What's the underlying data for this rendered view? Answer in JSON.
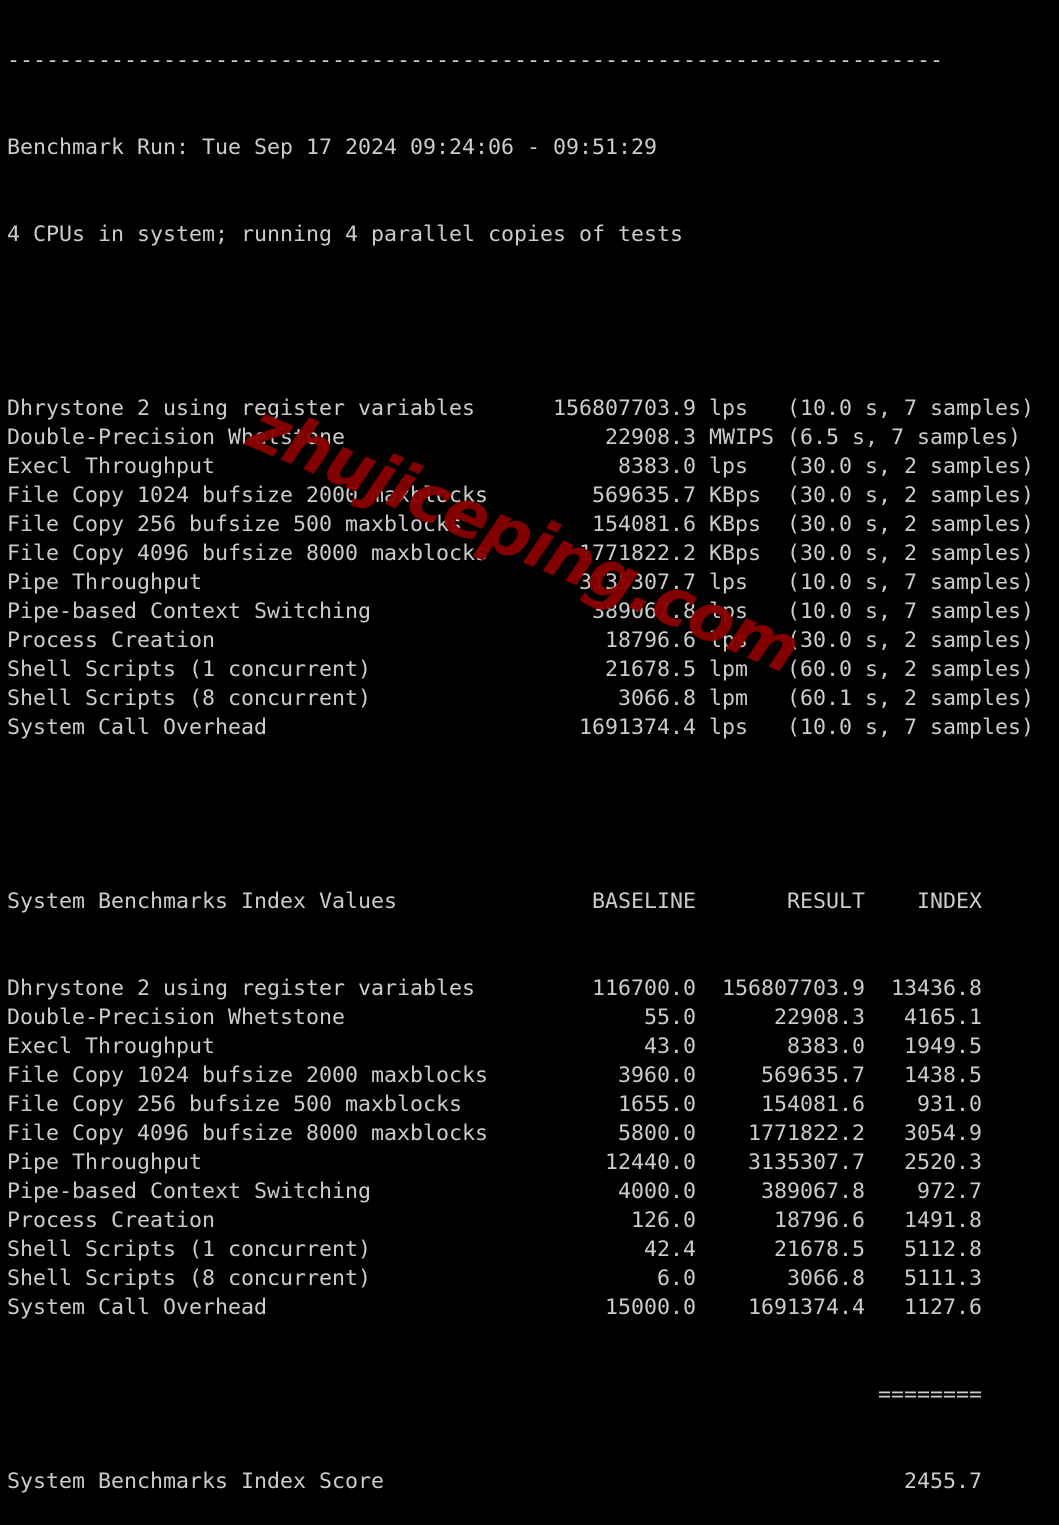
{
  "terminal": {
    "separator": "------------------------------------------------------------------------",
    "run_line": "Benchmark Run: Tue Sep 17 2024 09:24:06 - 09:51:29",
    "cpu_line": "4 CPUs in system; running 4 parallel copies of tests",
    "results": [
      {
        "name": "Dhrystone 2 using register variables",
        "value": "156807703.9",
        "unit": "lps",
        "info": "(10.0 s, 7 samples)"
      },
      {
        "name": "Double-Precision Whetstone",
        "value": "22908.3",
        "unit": "MWIPS",
        "info": "(6.5 s, 7 samples)"
      },
      {
        "name": "Execl Throughput",
        "value": "8383.0",
        "unit": "lps",
        "info": "(30.0 s, 2 samples)"
      },
      {
        "name": "File Copy 1024 bufsize 2000 maxblocks",
        "value": "569635.7",
        "unit": "KBps",
        "info": "(30.0 s, 2 samples)"
      },
      {
        "name": "File Copy 256 bufsize 500 maxblocks",
        "value": "154081.6",
        "unit": "KBps",
        "info": "(30.0 s, 2 samples)"
      },
      {
        "name": "File Copy 4096 bufsize 8000 maxblocks",
        "value": "1771822.2",
        "unit": "KBps",
        "info": "(30.0 s, 2 samples)"
      },
      {
        "name": "Pipe Throughput",
        "value": "3135307.7",
        "unit": "lps",
        "info": "(10.0 s, 7 samples)"
      },
      {
        "name": "Pipe-based Context Switching",
        "value": "389067.8",
        "unit": "lps",
        "info": "(10.0 s, 7 samples)"
      },
      {
        "name": "Process Creation",
        "value": "18796.6",
        "unit": "lps",
        "info": "(30.0 s, 2 samples)"
      },
      {
        "name": "Shell Scripts (1 concurrent)",
        "value": "21678.5",
        "unit": "lpm",
        "info": "(60.0 s, 2 samples)"
      },
      {
        "name": "Shell Scripts (8 concurrent)",
        "value": "3066.8",
        "unit": "lpm",
        "info": "(60.1 s, 2 samples)"
      },
      {
        "name": "System Call Overhead",
        "value": "1691374.4",
        "unit": "lps",
        "info": "(10.0 s, 7 samples)"
      }
    ],
    "index_header": {
      "title": "System Benchmarks Index Values",
      "baseline": "BASELINE",
      "result": "RESULT",
      "index": "INDEX"
    },
    "index_rows": [
      {
        "name": "Dhrystone 2 using register variables",
        "baseline": "116700.0",
        "result": "156807703.9",
        "index": "13436.8"
      },
      {
        "name": "Double-Precision Whetstone",
        "baseline": "55.0",
        "result": "22908.3",
        "index": "4165.1"
      },
      {
        "name": "Execl Throughput",
        "baseline": "43.0",
        "result": "8383.0",
        "index": "1949.5"
      },
      {
        "name": "File Copy 1024 bufsize 2000 maxblocks",
        "baseline": "3960.0",
        "result": "569635.7",
        "index": "1438.5"
      },
      {
        "name": "File Copy 256 bufsize 500 maxblocks",
        "baseline": "1655.0",
        "result": "154081.6",
        "index": "931.0"
      },
      {
        "name": "File Copy 4096 bufsize 8000 maxblocks",
        "baseline": "5800.0",
        "result": "1771822.2",
        "index": "3054.9"
      },
      {
        "name": "Pipe Throughput",
        "baseline": "12440.0",
        "result": "3135307.7",
        "index": "2520.3"
      },
      {
        "name": "Pipe-based Context Switching",
        "baseline": "4000.0",
        "result": "389067.8",
        "index": "972.7"
      },
      {
        "name": "Process Creation",
        "baseline": "126.0",
        "result": "18796.6",
        "index": "1491.8"
      },
      {
        "name": "Shell Scripts (1 concurrent)",
        "baseline": "42.4",
        "result": "21678.5",
        "index": "5112.8"
      },
      {
        "name": "Shell Scripts (8 concurrent)",
        "baseline": "6.0",
        "result": "3066.8",
        "index": "5111.3"
      },
      {
        "name": "System Call Overhead",
        "baseline": "15000.0",
        "result": "1691374.4",
        "index": "1127.6"
      }
    ],
    "score_rule": "========",
    "score_label": "System Benchmarks Index Score",
    "score_value": "2455.7"
  },
  "watermark": {
    "text": "zhujiceping.com",
    "color": "#8b0000"
  },
  "colors": {
    "background": "#000000",
    "text": "#cccccc"
  }
}
